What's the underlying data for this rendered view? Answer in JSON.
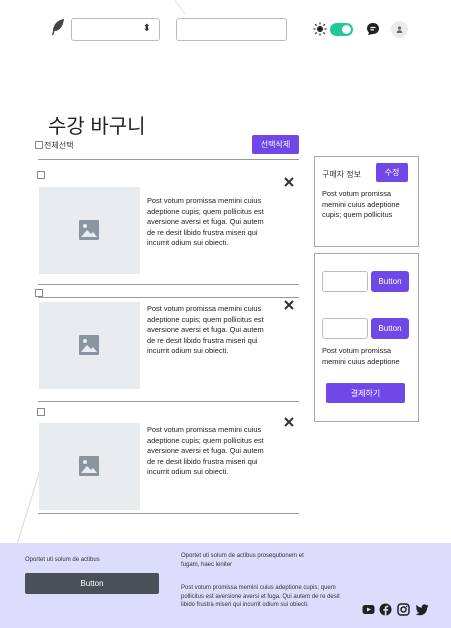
{
  "header": {
    "select_value": "",
    "search_value": "",
    "logo_icon": "feather-icon",
    "theme_icon": "sun-icon",
    "chat_icon": "chat-bubble-icon",
    "user_icon": "user-icon"
  },
  "cart": {
    "title": "수강 바구니",
    "select_all_label": "전체선택",
    "delete_selected_label": "선택삭제",
    "items": [
      {
        "description": "Post votum promissa memini cuius adeptione cupis; quem pollicitus est aversione aversi et fuga. Qui autem de re desit libido frustra miseri qui incurrit odium sui obiecti."
      },
      {
        "description": "Post votum promissa memini cuius adeptione cupis; quem pollicitus est aversione aversi et fuga. Qui autem de re desit libido frustra miseri qui incurrit odium sui obiecti."
      },
      {
        "description": "Post votum promissa memini cuius adeptione cupis; quem pollicitus est aversione aversi et fuga. Qui autem de re desit libido frustra miseri qui incurrit odium sui obiecti."
      }
    ]
  },
  "buyer": {
    "label": "구매자 정보",
    "edit_label": "수정",
    "text": "Post votum promissa memini cuius adeptione cupis; quem pollicitus"
  },
  "payment": {
    "button1_label": "Button",
    "button2_label": "Button",
    "text": "Post votum promissa memini cuius adeptione",
    "pay_label": "결제하기"
  },
  "footer": {
    "left_text": "Oportet uti solum de actibus",
    "button_label": "Button",
    "mid_title": "Oportet uti solum de actibus prosequtionem et fugam, haec leniter",
    "mid_body": "Post votum promissa memini cuius adeptione cupis; quem pollicitus est aversione aversi et fuga. Qui autem de re desit libido frustra miseri qui incurrit odium sui obiecti.",
    "social_icons": [
      "youtube-icon",
      "facebook-icon",
      "instagram-icon",
      "twitter-icon"
    ]
  },
  "colors": {
    "accent": "#7048e8",
    "toggle": "#20c997",
    "footer_bg": "#dcdcfd",
    "footer_button": "#495057"
  }
}
